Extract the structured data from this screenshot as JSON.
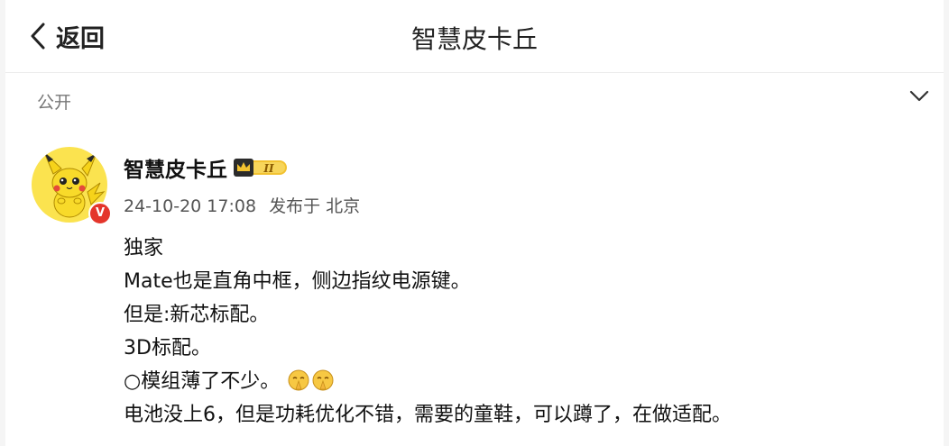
{
  "header": {
    "back_label": "返回",
    "title": "智慧皮卡丘"
  },
  "visibility": {
    "label": "公开",
    "icon": "chevron-down-icon"
  },
  "post": {
    "author": "智慧皮卡丘",
    "level_badge": "II",
    "verified_badge": "V",
    "timestamp": "24-10-20 17:08",
    "source": "发布于 北京",
    "lines": [
      "独家",
      "Mate也是直角中框，侧边指纹电源键。",
      "但是:新芯标配。",
      "3D标配。",
      "○模组薄了不少。",
      "电池没上6，但是功耗优化不错，需要的童鞋，可以蹲了，在做适配。"
    ]
  },
  "colors": {
    "avatar_bg": "#fbe34f",
    "verified_red": "#e4352b",
    "badge_gold": "#f2c230"
  }
}
